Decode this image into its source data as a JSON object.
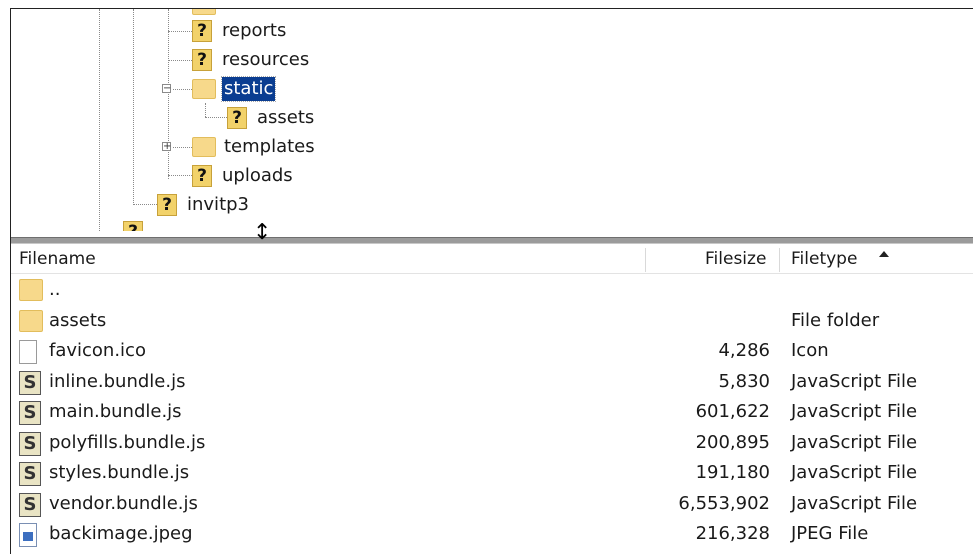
{
  "tree": {
    "nodes": [
      {
        "id": "reports",
        "label": "reports",
        "icon": "question-folder-icon"
      },
      {
        "id": "resources",
        "label": "resources",
        "icon": "question-folder-icon"
      },
      {
        "id": "static",
        "label": "static",
        "icon": "folder-icon",
        "expander": "−",
        "selected": true
      },
      {
        "id": "assets",
        "label": "assets",
        "icon": "question-folder-icon"
      },
      {
        "id": "templates",
        "label": "templates",
        "icon": "folder-icon",
        "expander": "+"
      },
      {
        "id": "uploads",
        "label": "uploads",
        "icon": "question-folder-icon"
      },
      {
        "id": "invitp3",
        "label": "invitp3",
        "icon": "question-folder-icon"
      }
    ],
    "question_mark": "?"
  },
  "list": {
    "columns": {
      "filename": "Filename",
      "filesize": "Filesize",
      "filetype": "Filetype"
    },
    "sort_indicator": "ascending",
    "rows": [
      {
        "name": "..",
        "size": "",
        "type": "",
        "icon": "folder-icon"
      },
      {
        "name": "assets",
        "size": "",
        "type": "File folder",
        "icon": "folder-icon"
      },
      {
        "name": "favicon.ico",
        "size": "4,286",
        "type": "Icon",
        "icon": "file-icon"
      },
      {
        "name": "inline.bundle.js",
        "size": "5,830",
        "type": "JavaScript File",
        "icon": "js-file-icon"
      },
      {
        "name": "main.bundle.js",
        "size": "601,622",
        "type": "JavaScript File",
        "icon": "js-file-icon"
      },
      {
        "name": "polyfills.bundle.js",
        "size": "200,895",
        "type": "JavaScript File",
        "icon": "js-file-icon"
      },
      {
        "name": "styles.bundle.js",
        "size": "191,180",
        "type": "JavaScript File",
        "icon": "js-file-icon"
      },
      {
        "name": "vendor.bundle.js",
        "size": "6,553,902",
        "type": "JavaScript File",
        "icon": "js-file-icon"
      },
      {
        "name": "backimage.jpeg",
        "size": "216,328",
        "type": "JPEG File",
        "icon": "image-file-icon"
      }
    ],
    "js_glyph": "S"
  },
  "colors": {
    "selection": "#0a3d91",
    "folder": "#f7d98b",
    "question": "#f2d26a"
  }
}
